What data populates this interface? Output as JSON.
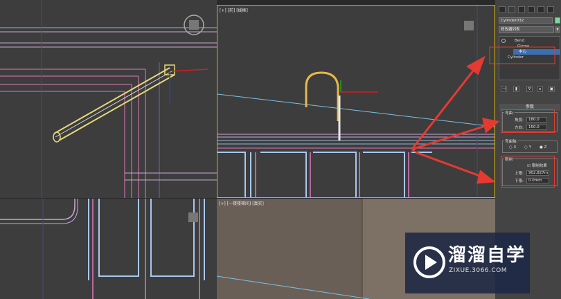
{
  "viewports": {
    "top_left": {
      "label": ""
    },
    "top_right": {
      "label": "[+] [前] [线框]"
    },
    "bottom_left": {
      "label": ""
    },
    "bottom_right": {
      "label": "[+] [一楼楼梯间] [真实]"
    }
  },
  "panel": {
    "object_name": "Cylinder032",
    "modifier_list": "修改器列表",
    "modifier_arrow": "▾",
    "stack": {
      "bend": "Bend",
      "gizmo": "Gizmo",
      "center": "中心",
      "cylinder": "Cylinder"
    },
    "rollout_title": "参数",
    "bend_group": {
      "label": "弯曲:",
      "angle_label": "角度:",
      "angle_value": "180.0",
      "direction_label": "方向:",
      "direction_value": "150.0"
    },
    "axis_group": {
      "label": "弯曲轴:",
      "x": "X",
      "y": "Y",
      "z": "Z",
      "selected": "Z"
    },
    "limits_group": {
      "label": "限制",
      "limit_effect_label": "限制效果",
      "limit_effect_checked": true,
      "upper_label": "上限:",
      "upper_value": "902.827m",
      "lower_label": "下限:",
      "lower_value": "0.0mm"
    }
  },
  "watermark": {
    "title": "溜溜自学",
    "subtitle": "ZIXUE.3066.COM"
  },
  "colors": {
    "highlight": "#e53a32",
    "viewport_active_border": "#d8b400",
    "selected_item": "#3d6fb0"
  }
}
